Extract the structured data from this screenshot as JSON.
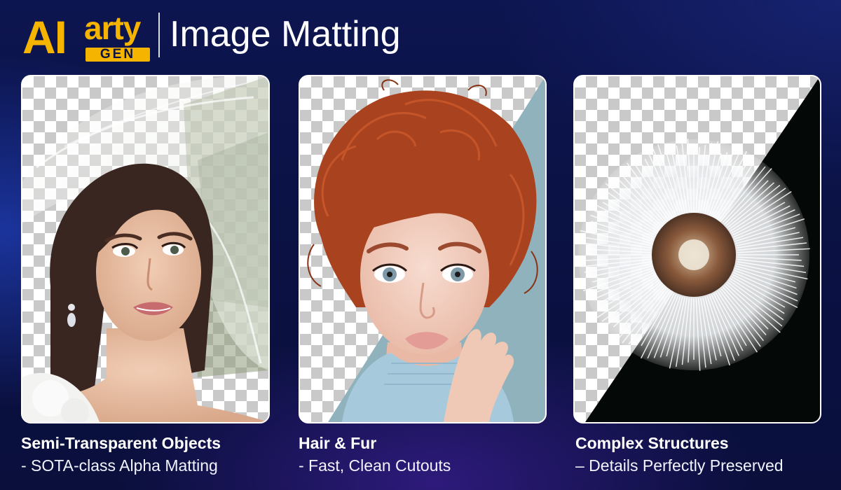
{
  "header": {
    "logo_ai": "AI",
    "logo_arty": "arty",
    "logo_gen": "GEN",
    "title": "Image Matting"
  },
  "colors": {
    "brand_yellow": "#f5b400",
    "background": "#0b1244",
    "card_border": "#ffffff"
  },
  "features": [
    {
      "title": "Semi-Transparent Objects",
      "subtitle": "- SOTA-class Alpha Matting",
      "image": "bride-with-veil"
    },
    {
      "title": "Hair & Fur",
      "subtitle": "- Fast, Clean Cutouts",
      "image": "red-haired-woman"
    },
    {
      "title": "Complex Structures",
      "subtitle": "– Details Perfectly Preserved",
      "image": "dandelion-seed-head"
    }
  ]
}
